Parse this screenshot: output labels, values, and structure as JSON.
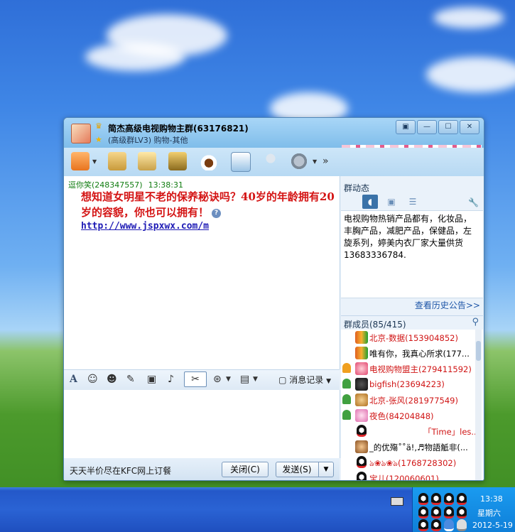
{
  "window": {
    "group_name": "简杰高级电视购物主群(63176821)",
    "group_sub": "(高级群LV3) 购物-其他",
    "controls": [
      "▣",
      "—",
      "☐",
      "✕"
    ]
  },
  "chat": {
    "sender": "逗你笑(248347557)",
    "time": "13:38:31",
    "message": "想知道女明星不老的保养秘诀吗？40岁的年龄拥有20岁的容貌，你也可以拥有！",
    "link": "http://www.jspxwx.com/m"
  },
  "input_toolbar": {
    "history_label": "消息记录"
  },
  "bottom": {
    "ad_text": "天天半价尽在KFC网上订餐",
    "close_label": "关闭(C)",
    "send_label": "发送(S)"
  },
  "right": {
    "dyn_title": "群动态",
    "notice": "电视购物热销产品都有，化妆品，丰胸产品，减肥产品，保健品，左旋系列，婷美内衣厂家大量供货13683336784.",
    "notice_more": "查看历史公告>>",
    "members_title": "群成员(85/415)",
    "members": [
      {
        "name": "北京-数据(153904852)",
        "role": "none",
        "red": true
      },
      {
        "name": "唯有你，我真心所求(177...",
        "role": "none",
        "red": false
      },
      {
        "name": "电视购物盟主(279411592)",
        "role": "owner",
        "red": true
      },
      {
        "name": "bigfish(23694223)",
        "role": "admin",
        "red": true
      },
      {
        "name": "北京-张风(281977549)",
        "role": "admin",
        "red": true
      },
      {
        "name": "夜色(84204848)",
        "role": "admin",
        "red": true
      },
      {
        "name": "「Time」les...",
        "role": "none",
        "red": true
      },
      {
        "name": "_的优殤˚˚ä!,♬物語觝非(...",
        "role": "none",
        "red": false
      },
      {
        "name": "ঌ❀ঌ❀ঌ(1768728302)",
        "role": "none",
        "red": true
      },
      {
        "name": "宝儿(120060601)",
        "role": "none",
        "red": true
      }
    ]
  },
  "tray": {
    "time": "13:38",
    "day": "星期六",
    "date": "2012-5-19"
  }
}
